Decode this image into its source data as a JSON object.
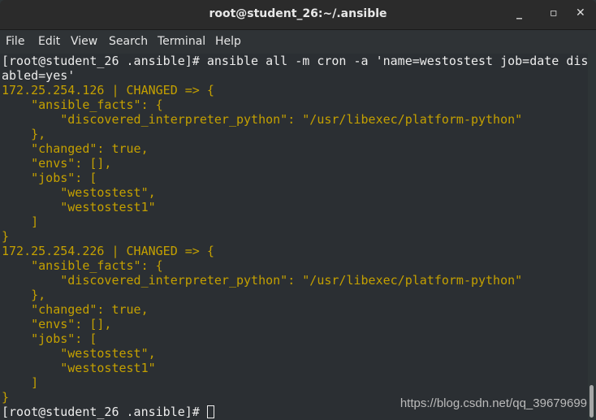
{
  "window": {
    "title": "root@student_26:~/.ansible",
    "minimize": "_",
    "maximize": "▫",
    "close": "✕"
  },
  "menu": [
    "File",
    "Edit",
    "View",
    "Search",
    "Terminal",
    "Help"
  ],
  "colors": {
    "output": "#c4a000",
    "text": "#ededed",
    "background": "#2b2f33"
  },
  "terminal": {
    "lines": [
      {
        "t": "[root@student_26 .ansible]# ansible all -m cron -a 'name=westostest job=date dis",
        "c": ""
      },
      {
        "t": "abled=yes'",
        "c": ""
      },
      {
        "t": "172.25.254.126 | CHANGED => {",
        "c": "y"
      },
      {
        "t": "    \"ansible_facts\": {",
        "c": "y"
      },
      {
        "t": "        \"discovered_interpreter_python\": \"/usr/libexec/platform-python\"",
        "c": "y"
      },
      {
        "t": "    },",
        "c": "y"
      },
      {
        "t": "    \"changed\": true,",
        "c": "y"
      },
      {
        "t": "    \"envs\": [],",
        "c": "y"
      },
      {
        "t": "    \"jobs\": [",
        "c": "y"
      },
      {
        "t": "        \"westostest\",",
        "c": "y"
      },
      {
        "t": "        \"westostest1\"",
        "c": "y"
      },
      {
        "t": "    ]",
        "c": "y"
      },
      {
        "t": "}",
        "c": "y"
      },
      {
        "t": "172.25.254.226 | CHANGED => {",
        "c": "y"
      },
      {
        "t": "    \"ansible_facts\": {",
        "c": "y"
      },
      {
        "t": "        \"discovered_interpreter_python\": \"/usr/libexec/platform-python\"",
        "c": "y"
      },
      {
        "t": "    },",
        "c": "y"
      },
      {
        "t": "    \"changed\": true,",
        "c": "y"
      },
      {
        "t": "    \"envs\": [],",
        "c": "y"
      },
      {
        "t": "    \"jobs\": [",
        "c": "y"
      },
      {
        "t": "        \"westostest\",",
        "c": "y"
      },
      {
        "t": "        \"westostest1\"",
        "c": "y"
      },
      {
        "t": "    ]",
        "c": "y"
      },
      {
        "t": "}",
        "c": "y"
      }
    ],
    "prompt": "[root@student_26 .ansible]# "
  },
  "watermark": "https://blog.csdn.net/qq_39679699"
}
